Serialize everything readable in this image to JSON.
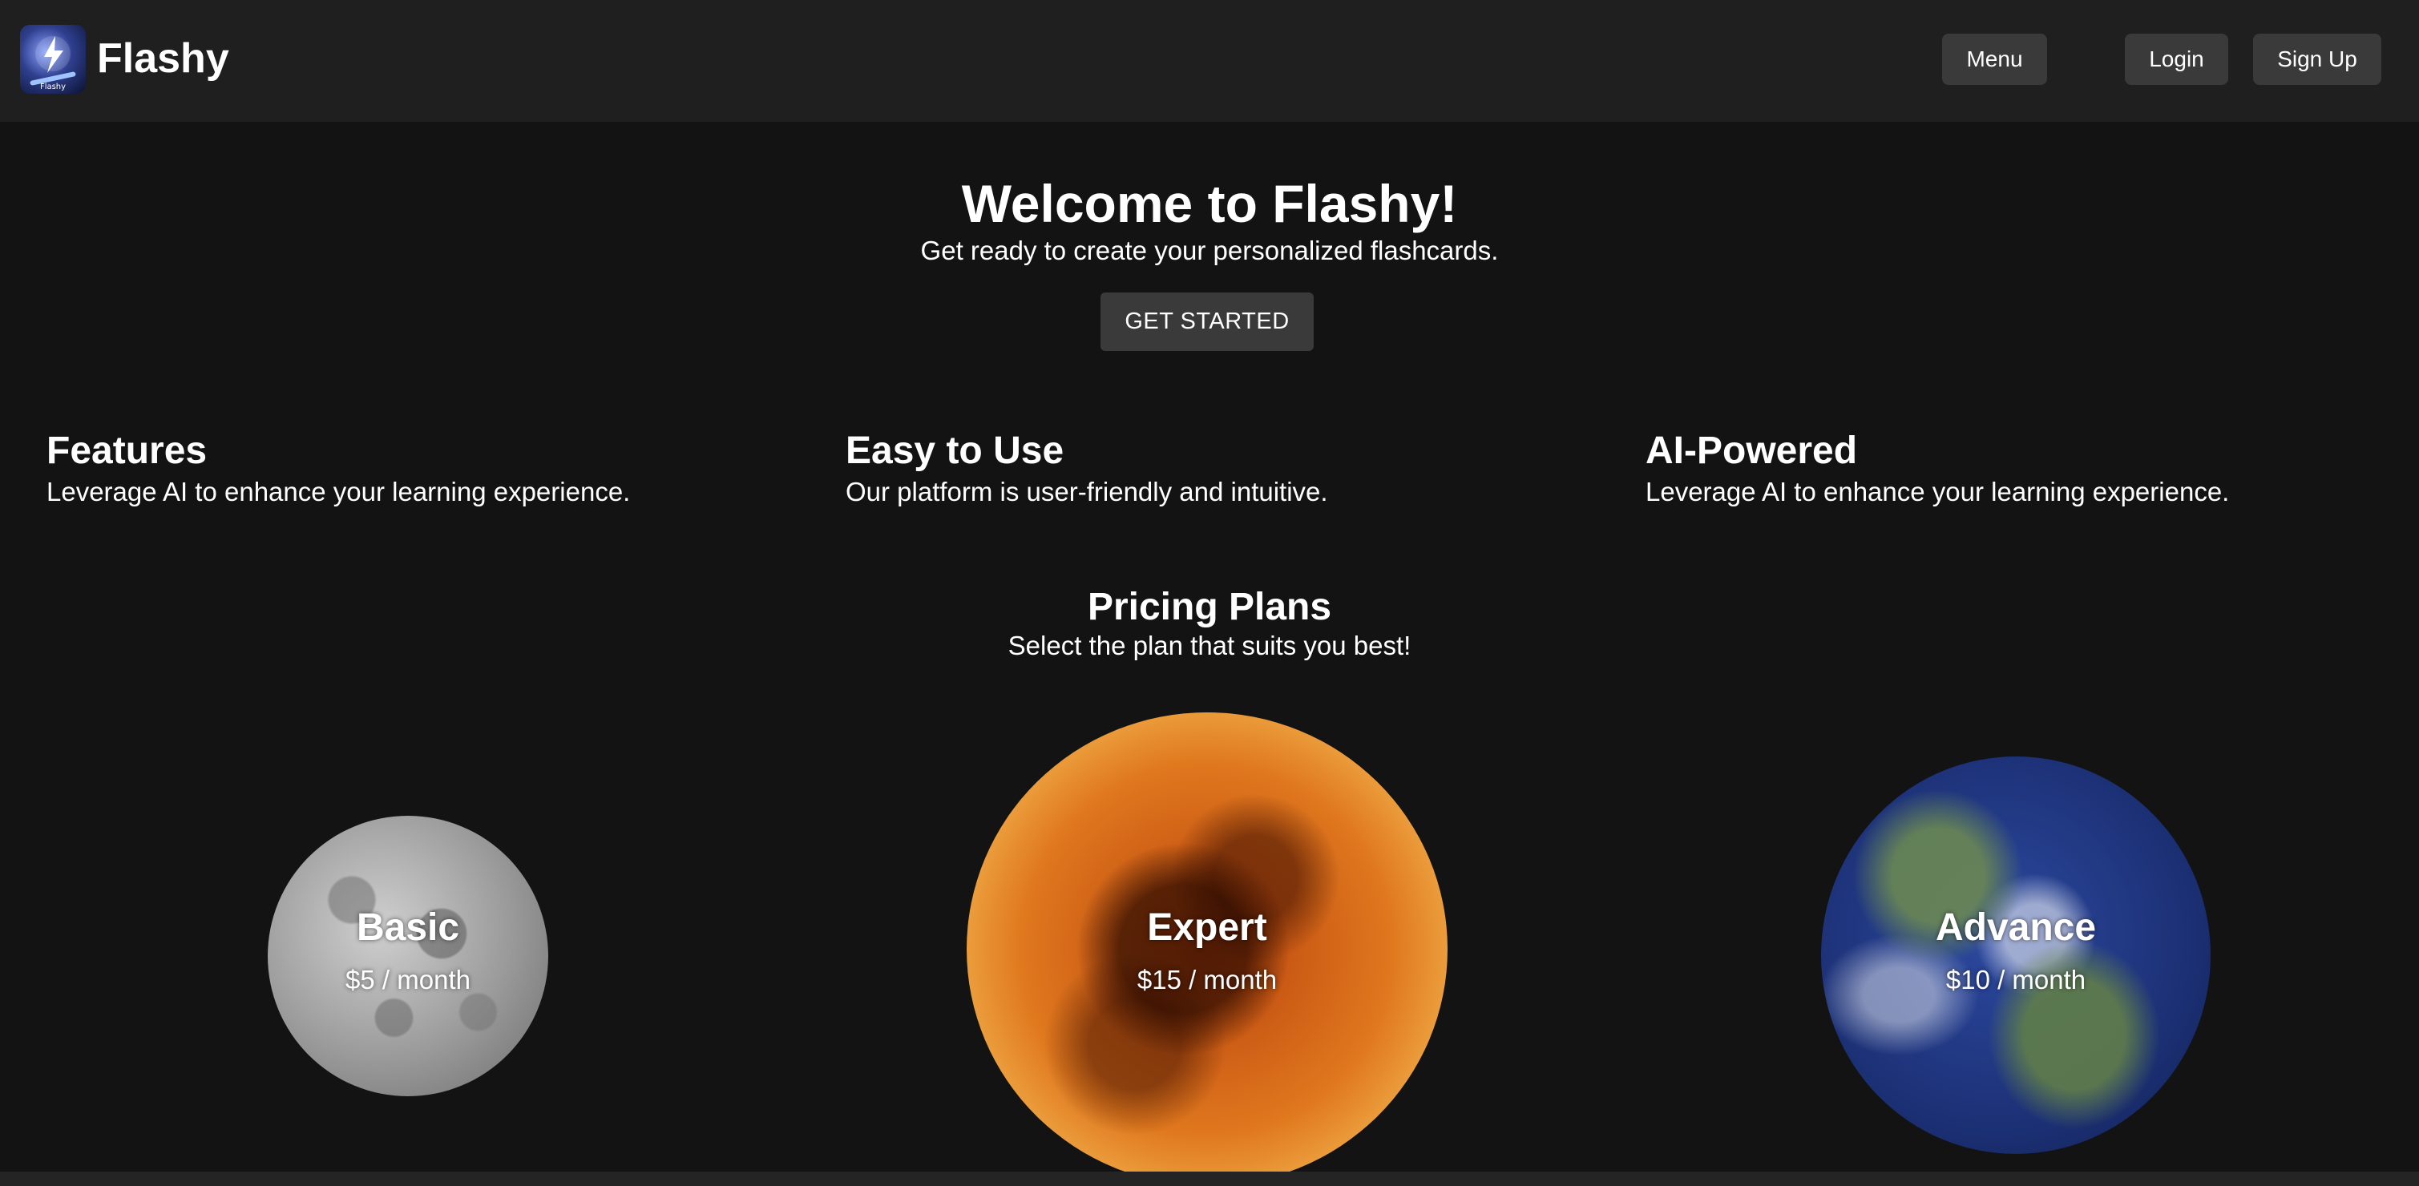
{
  "navbar": {
    "brand": "Flashy",
    "logo_text": "Flashy",
    "menu_label": "Menu",
    "login_label": "Login",
    "signup_label": "Sign Up"
  },
  "hero": {
    "title": "Welcome to Flashy!",
    "subtitle": "Get ready to create your personalized flashcards.",
    "cta_label": "GET STARTED"
  },
  "features": [
    {
      "title": "Features",
      "description": "Leverage AI to enhance your learning experience."
    },
    {
      "title": "Easy to Use",
      "description": "Our platform is user-friendly and intuitive."
    },
    {
      "title": "AI-Powered",
      "description": "Leverage AI to enhance your learning experience."
    }
  ],
  "pricing": {
    "title": "Pricing Plans",
    "subtitle": "Select the plan that suits you best!",
    "plans": [
      {
        "name": "Basic",
        "price": "$5 / month",
        "image": "moon"
      },
      {
        "name": "Expert",
        "price": "$15 / month",
        "image": "sun"
      },
      {
        "name": "Advance",
        "price": "$10 / month",
        "image": "earth"
      }
    ]
  },
  "colors": {
    "background": "#131313",
    "navbar": "#1f1f1f",
    "button": "#3a3a3a",
    "text": "#ffffff"
  }
}
